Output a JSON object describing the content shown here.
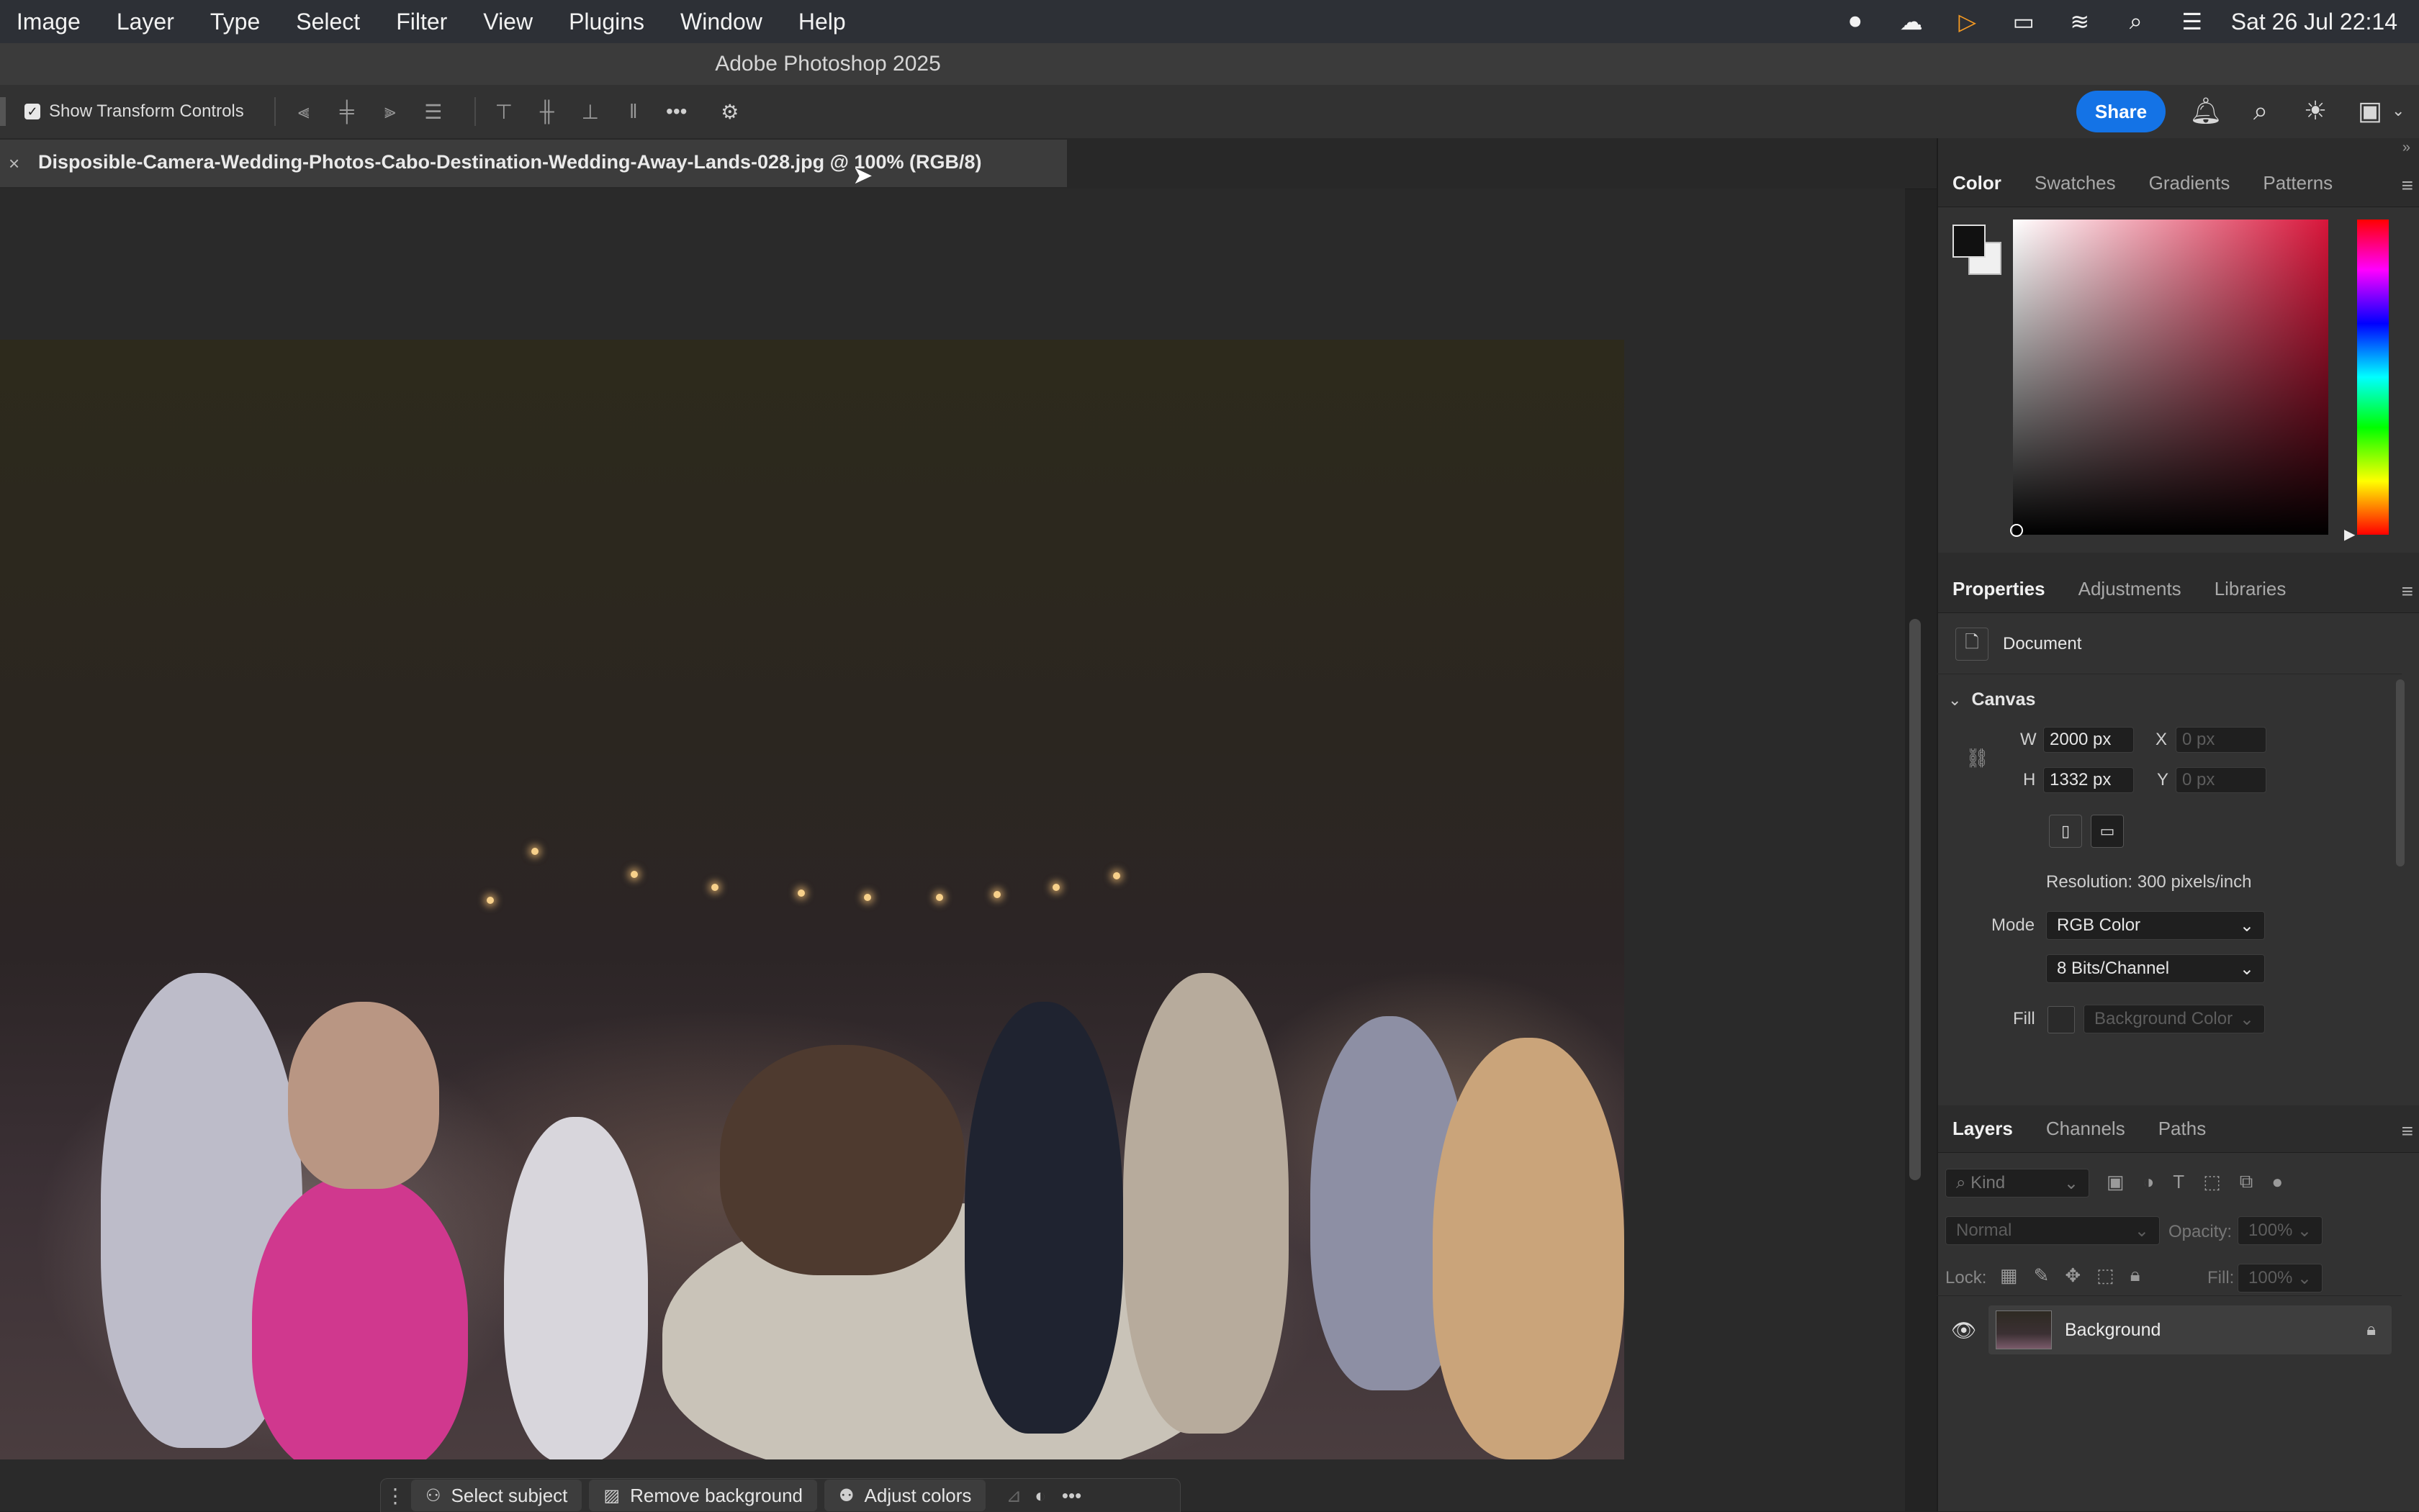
{
  "menubar": {
    "items": [
      "Image",
      "Layer",
      "Type",
      "Select",
      "Filter",
      "View",
      "Plugins",
      "Window",
      "Help"
    ],
    "clock": "Sat 26 Jul 22:14"
  },
  "app": {
    "title": "Adobe Photoshop 2025"
  },
  "options_bar": {
    "show_transform_label": "Show Transform Controls",
    "show_transform_checked": true,
    "share_label": "Share"
  },
  "document": {
    "tab_title": "Disposible-Camera-Wedding-Photos-Cabo-Destination-Wedding-Away-Lands-028.jpg @ 100% (RGB/8)"
  },
  "color_panel": {
    "tabs": [
      "Color",
      "Swatches",
      "Gradients",
      "Patterns"
    ],
    "foreground": "#111111",
    "background": "#f0f0f0"
  },
  "properties_panel": {
    "tabs": [
      "Properties",
      "Adjustments",
      "Libraries"
    ],
    "document_label": "Document",
    "canvas_label": "Canvas",
    "w_label": "W",
    "w_value": "2000 px",
    "h_label": "H",
    "h_value": "1332 px",
    "x_label": "X",
    "x_placeholder": "0 px",
    "y_label": "Y",
    "y_placeholder": "0 px",
    "resolution": "Resolution: 300 pixels/inch",
    "mode_label": "Mode",
    "mode_value": "RGB Color",
    "bits_value": "8 Bits/Channel",
    "fill_label": "Fill",
    "fill_value": "Background Color"
  },
  "layers_panel": {
    "tabs": [
      "Layers",
      "Channels",
      "Paths"
    ],
    "filter_label": "Kind",
    "blend_mode": "Normal",
    "opacity_label": "Opacity:",
    "opacity_value": "100%",
    "lock_label": "Lock:",
    "fill_label": "Fill:",
    "fill_value": "100%",
    "layers": [
      {
        "name": "Background",
        "visible": true,
        "locked": true
      }
    ]
  },
  "task_bar": {
    "select_subject": "Select subject",
    "remove_background": "Remove background",
    "adjust_colors": "Adjust colors"
  }
}
